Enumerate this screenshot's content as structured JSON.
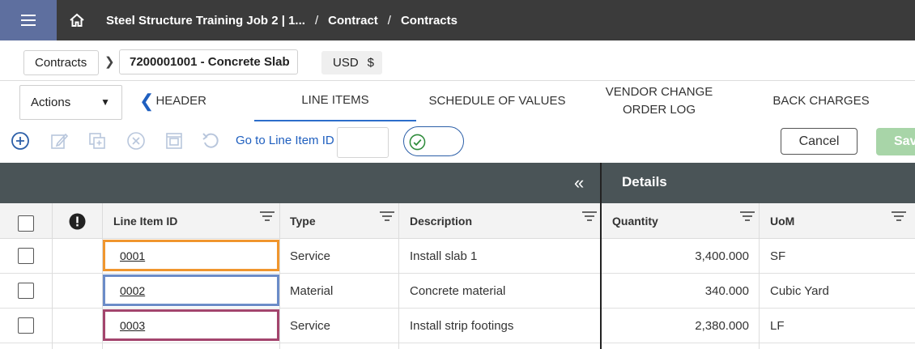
{
  "breadcrumb": {
    "project": "Steel Structure Training Job 2 | 1...",
    "contract": "Contract",
    "contracts": "Contracts",
    "separator": "/"
  },
  "row2": {
    "contracts_chip": "Contracts",
    "contract_chip": "7200001001 - Concrete Slab",
    "currency": "USD",
    "currency_symbol": "$"
  },
  "actions_label": "Actions",
  "tabs": {
    "header": "HEADER",
    "line_items": "LINE ITEMS",
    "schedule_of_values": "SCHEDULE OF VALUES",
    "vendor_change_line1": "VENDOR CHANGE",
    "vendor_change_line2": "ORDER LOG",
    "back_charges": "BACK CHARGES"
  },
  "toolbar": {
    "goto_label": "Go to Line Item ID",
    "goto_value": "",
    "cancel": "Cancel",
    "save": "Save"
  },
  "grid": {
    "details_title": "Details",
    "columns": {
      "line_item_id": "Line Item ID",
      "type": "Type",
      "description": "Description",
      "quantity": "Quantity",
      "uom": "UoM"
    },
    "rows": [
      {
        "id": "0001",
        "type": "Service",
        "description": "Install slab 1",
        "quantity": "3,400.000",
        "uom": "SF",
        "highlight": "#f0962e"
      },
      {
        "id": "0002",
        "type": "Material",
        "description": "Concrete material",
        "quantity": "340.000",
        "uom": "Cubic Yard",
        "highlight": "#6b8cc8"
      },
      {
        "id": "0003",
        "type": "Service",
        "description": "Install strip footings",
        "quantity": "2,380.000",
        "uom": "LF",
        "highlight": "#a3456d"
      }
    ]
  },
  "colors": {
    "topbar": "#3b3b3b",
    "menu": "#5e6f9f",
    "accent_blue": "#2c6ecb",
    "grid_header": "#4a5457",
    "save_disabled": "#a8d5a8"
  },
  "icons": {
    "menu": "hamburger-icon",
    "home": "home-icon",
    "add": "add-circle-icon",
    "edit": "edit-icon",
    "copy": "copy-icon",
    "cancel_item": "cancel-circle-icon",
    "print": "print-icon",
    "undo": "undo-icon",
    "toggle": "check-circle-icon",
    "collapse": "double-chevron-left-icon",
    "filter": "filter-icon",
    "alert": "alert-circle-icon"
  }
}
